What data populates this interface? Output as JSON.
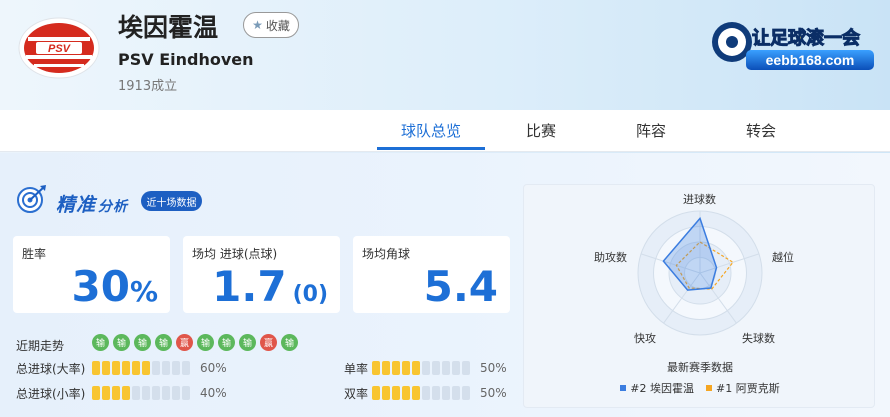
{
  "header": {
    "team_name": "埃因霍温",
    "favorite_label": "收藏",
    "english_name": "PSV Eindhoven",
    "founded": "1913成立",
    "logo_text": "PSV",
    "promo_text": "让足球滚一会",
    "promo_url_text": "eebb168.com"
  },
  "tabs": [
    {
      "label": "球队总览",
      "active": true
    },
    {
      "label": "比赛",
      "active": false
    },
    {
      "label": "阵容",
      "active": false
    },
    {
      "label": "转会",
      "active": false
    }
  ],
  "analysis": {
    "title_main": "精准",
    "title_sub": "分析",
    "badge": "近十场数据",
    "stats": [
      {
        "label": "胜率",
        "value": "30",
        "unit": "%",
        "extra": ""
      },
      {
        "label": "场均 进球(点球)",
        "value": "1.7",
        "unit": "",
        "extra": "(0)"
      },
      {
        "label": "场均角球",
        "value": "5.4",
        "unit": "",
        "extra": ""
      }
    ],
    "trend_label": "近期走势",
    "trend": [
      {
        "text": "输",
        "result": "loss"
      },
      {
        "text": "输",
        "result": "loss"
      },
      {
        "text": "输",
        "result": "loss"
      },
      {
        "text": "输",
        "result": "loss"
      },
      {
        "text": "赢",
        "result": "win"
      },
      {
        "text": "输",
        "result": "loss"
      },
      {
        "text": "输",
        "result": "loss"
      },
      {
        "text": "输",
        "result": "loss"
      },
      {
        "text": "赢",
        "result": "win"
      },
      {
        "text": "输",
        "result": "loss"
      }
    ],
    "trend_colors": {
      "loss": "#5cb85c",
      "win": "#e0564a"
    },
    "meters": [
      {
        "label": "总进球(大率)",
        "value": "60%",
        "fraction": 0.6
      },
      {
        "label": "总进球(小率)",
        "value": "40%",
        "fraction": 0.4
      },
      {
        "label": "单率",
        "value": "50%",
        "fraction": 0.5
      },
      {
        "label": "双率",
        "value": "50%",
        "fraction": 0.5
      }
    ]
  },
  "radar": {
    "axes": [
      "进球数",
      "越位",
      "失球数",
      "快攻",
      "助攻数"
    ],
    "caption": "最新赛季数据",
    "series": [
      {
        "name": "#2 埃因霍温",
        "color": "#3b7de0",
        "values": [
          0.88,
          0.28,
          0.3,
          0.34,
          0.62
        ]
      },
      {
        "name": "#1 阿贾克斯",
        "color": "#f5a623",
        "values": [
          0.5,
          0.56,
          0.32,
          0.3,
          0.4
        ]
      }
    ]
  }
}
